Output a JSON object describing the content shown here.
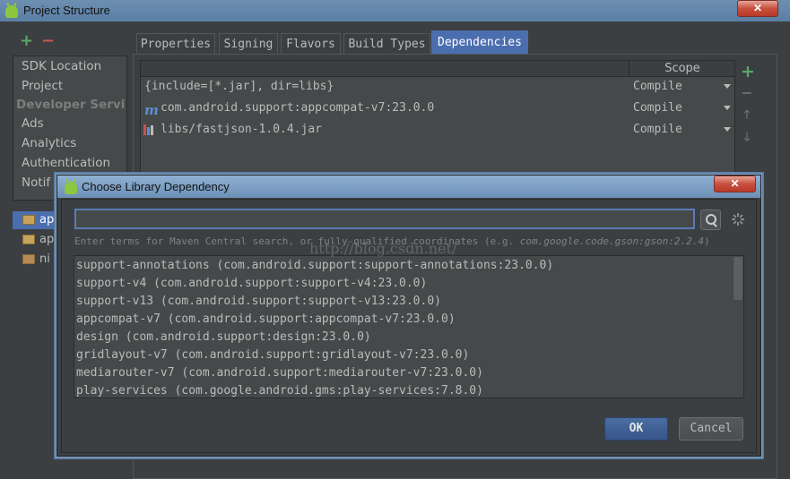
{
  "window": {
    "title": "Project Structure",
    "close_label": "✕"
  },
  "left_toolbar": {
    "add": "+",
    "remove": "−"
  },
  "left_panel": {
    "items": [
      "SDK Location",
      "Project"
    ],
    "section_header": "Developer Servi",
    "services": [
      "Ads",
      "Analytics",
      "Authentication",
      "Notif"
    ]
  },
  "modules": [
    "ap",
    "ap",
    "ni"
  ],
  "tabs": [
    "Properties",
    "Signing",
    "Flavors",
    "Build Types",
    "Dependencies"
  ],
  "active_tab": "Dependencies",
  "dependencies": {
    "scope_header": "Scope",
    "rows": [
      {
        "name": "{include=[*.jar], dir=libs}",
        "scope": "Compile",
        "icon": "none"
      },
      {
        "name": "com.android.support:appcompat-v7:23.0.0",
        "scope": "Compile",
        "icon": "maven-m-icon",
        "icon_glyph": "m"
      },
      {
        "name": "libs/fastjson-1.0.4.jar",
        "scope": "Compile",
        "icon": "jar-library-icon"
      }
    ],
    "side_buttons": {
      "add": "+",
      "remove": "−",
      "up": "🡑",
      "down": "🡓"
    }
  },
  "dialog": {
    "title": "Choose Library Dependency",
    "close_label": "✕",
    "search": {
      "value": "",
      "placeholder": ""
    },
    "hint_prefix": "Enter terms for Maven Central search, or fully-qualified coordinates (e.g. ",
    "hint_example": "com.google.code.gson:gson:2.2.4",
    "hint_suffix": ")",
    "results": [
      "support-annotations (com.android.support:support-annotations:23.0.0)",
      "support-v4 (com.android.support:support-v4:23.0.0)",
      "support-v13 (com.android.support:support-v13:23.0.0)",
      "appcompat-v7 (com.android.support:appcompat-v7:23.0.0)",
      "design (com.android.support:design:23.0.0)",
      "gridlayout-v7 (com.android.support:gridlayout-v7:23.0.0)",
      "mediarouter-v7 (com.android.support:mediarouter-v7:23.0.0)",
      "play-services (com.google.android.gms:play-services:7.8.0)"
    ],
    "watermark": "http://blog.csdn.net/",
    "ok_label": "OK",
    "cancel_label": "Cancel"
  },
  "colors": {
    "accent": "#4b6eaf",
    "add_green": "#59a869",
    "remove_red": "#c75450",
    "android_green": "#8dc63f"
  }
}
